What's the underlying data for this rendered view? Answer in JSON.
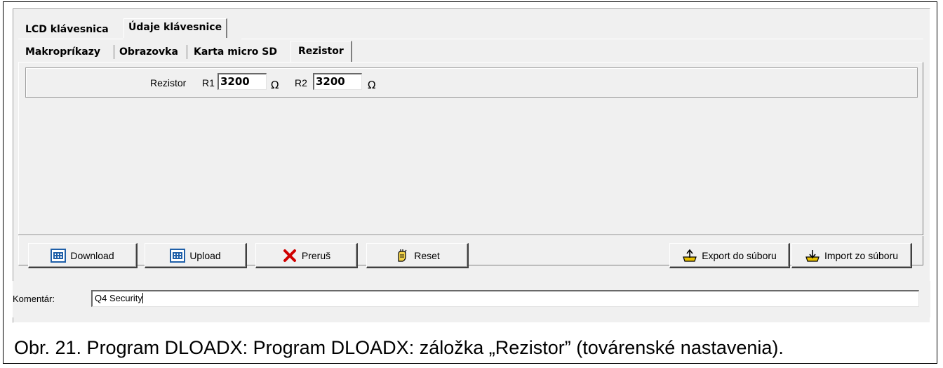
{
  "tabs_top": [
    {
      "label": "LCD klávesnica",
      "active": false
    },
    {
      "label": "Údaje klávesnice",
      "active": true
    }
  ],
  "tabs_sub": [
    {
      "label": "Makropríkazy",
      "active": false
    },
    {
      "label": "Obrazovka",
      "active": false
    },
    {
      "label": "Karta micro SD",
      "active": false
    },
    {
      "label": "Rezistor",
      "active": true
    }
  ],
  "rezistor": {
    "label": "Rezistor",
    "r1_label": "R1",
    "r1_value": "3200",
    "r2_label": "R2",
    "r2_value": "3200",
    "unit": "Ω"
  },
  "buttons": {
    "download": "Download",
    "upload": "Upload",
    "cancel": "Preruš",
    "reset": "Reset",
    "export": "Export do súboru",
    "import": "Import zo súboru"
  },
  "comment": {
    "label": "Komentár:",
    "value": "Q4 Security"
  },
  "caption": "Obr. 21. Program DLOADX: Program DLOADX: záložka „Rezistor” (továrenské nastavenia).",
  "icons": {
    "download": "computer-download-icon",
    "upload": "computer-upload-icon",
    "cancel": "red-x-icon",
    "reset": "hand-reset-icon",
    "export": "tray-export-icon",
    "import": "tray-import-icon"
  },
  "colors": {
    "window_bg": "#f0f0f0",
    "cancel_red": "#d00000",
    "icon_blue": "#1f5fa8",
    "export_yellow": "#e8c000"
  }
}
